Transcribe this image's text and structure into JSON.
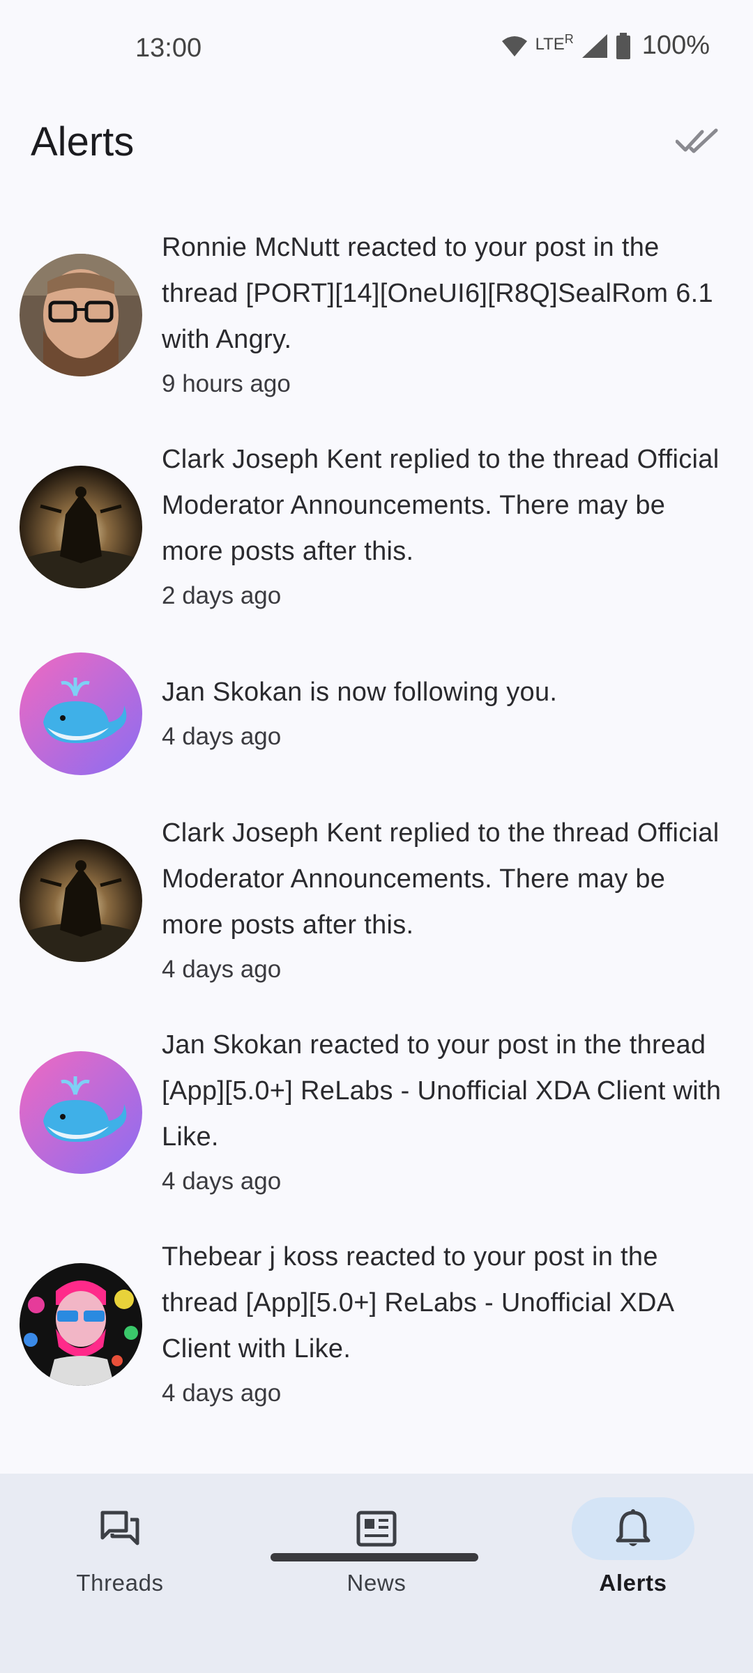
{
  "status_bar": {
    "time": "13:00",
    "network": "LTE",
    "roaming": "R",
    "battery": "100%",
    "icons": [
      "wifi-icon",
      "signal-icon",
      "battery-icon"
    ]
  },
  "header": {
    "title": "Alerts",
    "mark_all_read_icon": "double-check-icon"
  },
  "alerts": [
    {
      "text": "Ronnie McNutt reacted to your post in the thread [PORT][14][OneUI6][R8Q]SealRom 6.1 with Angry.",
      "time": "9 hours ago",
      "avatar": "avatar-ronnie"
    },
    {
      "text": "Clark Joseph Kent replied to the thread Official Moderator Announcements. There may be more posts after this.",
      "time": "2 days ago",
      "avatar": "avatar-clark"
    },
    {
      "text": "Jan Skokan is now following you.",
      "time": "4 days ago",
      "avatar": "avatar-jan"
    },
    {
      "text": "Clark Joseph Kent replied to the thread Official Moderator Announcements. There may be more posts after this.",
      "time": "4 days ago",
      "avatar": "avatar-clark"
    },
    {
      "text": "Jan Skokan reacted to your post in the thread [App][5.0+] ReLabs - Unofficial XDA Client with Like.",
      "time": "4 days ago",
      "avatar": "avatar-jan"
    },
    {
      "text": "Thebear j koss reacted to your post in the thread [App][5.0+] ReLabs - Unofficial XDA Client with Like.",
      "time": "4 days ago",
      "avatar": "avatar-thebear"
    }
  ],
  "bottom_nav": {
    "items": [
      {
        "label": "Threads",
        "icon": "forum-icon",
        "active": false
      },
      {
        "label": "News",
        "icon": "newspaper-icon",
        "active": false
      },
      {
        "label": "Alerts",
        "icon": "bell-icon",
        "active": true
      }
    ]
  },
  "colors": {
    "background": "#f9f9fd",
    "nav_background": "#e8ebf3",
    "active_pill": "#d4e4f6"
  }
}
